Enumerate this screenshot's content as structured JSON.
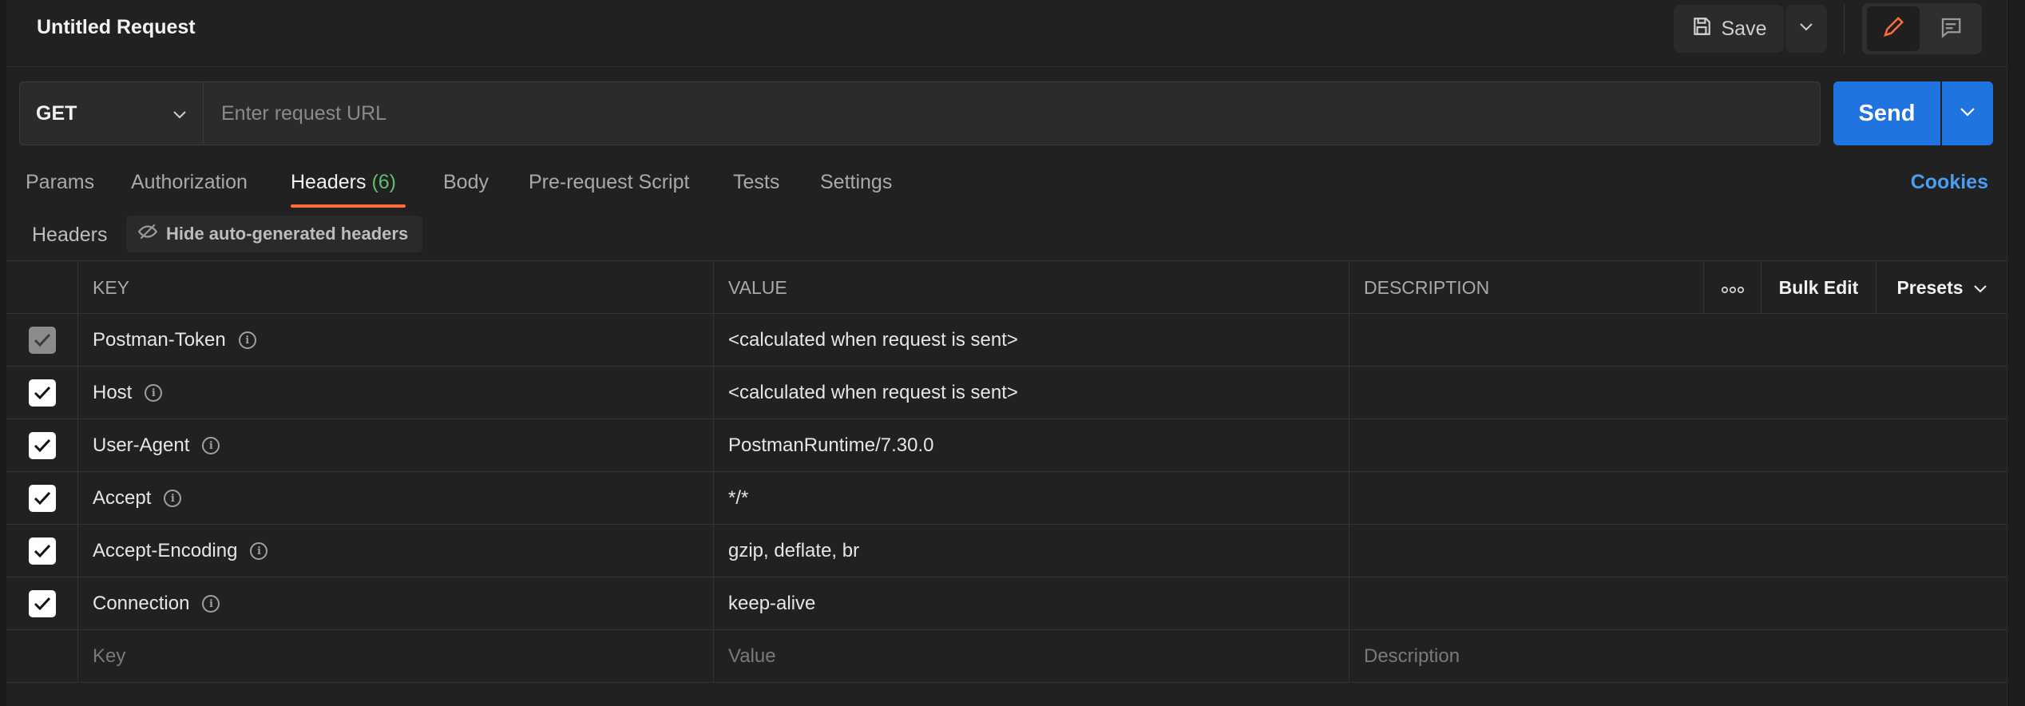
{
  "window": {
    "title": "Untitled Request"
  },
  "toolbar": {
    "save_label": "Save",
    "save_icon": "floppy-disk-icon",
    "edit_icon": "pencil-icon",
    "comment_icon": "comment-icon"
  },
  "request": {
    "method": "GET",
    "url_value": "",
    "url_placeholder": "Enter request URL",
    "send_label": "Send"
  },
  "tabs": [
    {
      "label": "Params"
    },
    {
      "label": "Authorization"
    },
    {
      "label": "Headers",
      "count": "(6)",
      "active": true
    },
    {
      "label": "Body"
    },
    {
      "label": "Pre-request Script"
    },
    {
      "label": "Tests"
    },
    {
      "label": "Settings"
    }
  ],
  "cookies_label": "Cookies",
  "headers_section": {
    "title": "Headers",
    "hide_button_label": "Hide auto-generated headers"
  },
  "table": {
    "columns": {
      "key": "KEY",
      "value": "VALUE",
      "description": "DESCRIPTION",
      "bulk_edit": "Bulk Edit",
      "presets": "Presets"
    },
    "rows": [
      {
        "key": "Postman-Token",
        "value": "<calculated when request is sent>",
        "description": "",
        "checked": true,
        "disabled": true
      },
      {
        "key": "Host",
        "value": "<calculated when request is sent>",
        "description": "",
        "checked": true
      },
      {
        "key": "User-Agent",
        "value": "PostmanRuntime/7.30.0",
        "description": "",
        "checked": true
      },
      {
        "key": "Accept",
        "value": "*/*",
        "description": "",
        "checked": true
      },
      {
        "key": "Accept-Encoding",
        "value": "gzip, deflate, br",
        "description": "",
        "checked": true
      },
      {
        "key": "Connection",
        "value": "keep-alive",
        "description": "",
        "checked": true
      }
    ],
    "placeholders": {
      "key": "Key",
      "value": "Value",
      "description": "Description"
    }
  },
  "colors": {
    "accent": "#ff6c37",
    "send": "#1f74e0",
    "link": "#4a9df5",
    "count": "#5fbf6a"
  }
}
